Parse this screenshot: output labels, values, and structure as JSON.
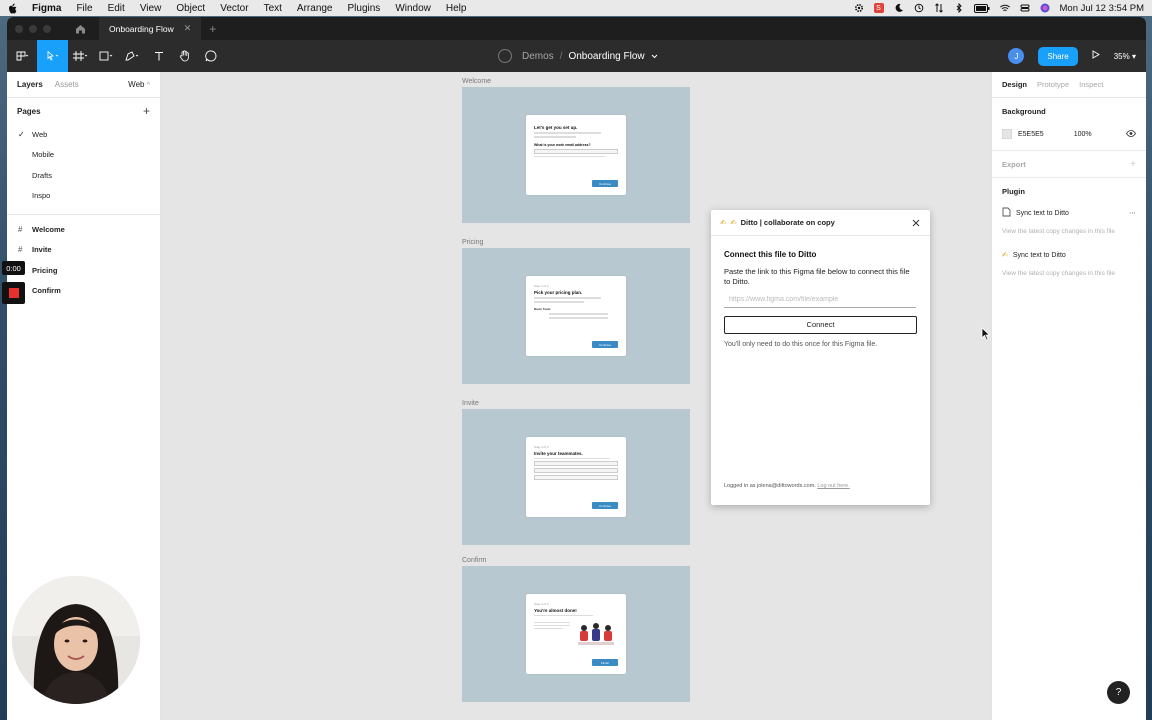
{
  "menubar": {
    "app": "Figma",
    "items": [
      "File",
      "Edit",
      "View",
      "Object",
      "Vector",
      "Text",
      "Arrange",
      "Plugins",
      "Window",
      "Help"
    ],
    "clock": "Mon Jul 12  3:54 PM",
    "status_badge": "S"
  },
  "tabbar": {
    "file_tab": "Onboarding Flow"
  },
  "toolbar": {
    "team": "Demos",
    "separator": "/",
    "file_name": "Onboarding Flow",
    "avatar_initial": "J",
    "share": "Share",
    "zoom": "35%"
  },
  "left_panel": {
    "tabs": [
      "Layers",
      "Assets"
    ],
    "page_selector": "Web",
    "pages_heading": "Pages",
    "pages": [
      "Web",
      "Mobile",
      "Drafts",
      "Inspo"
    ],
    "current_page": "Web",
    "frames": [
      "Welcome",
      "Invite",
      "Pricing",
      "Confirm"
    ]
  },
  "recorder": {
    "time": "0:00"
  },
  "canvas": {
    "frames": [
      {
        "label": "Welcome",
        "card_small": "",
        "card_title": "Let's get you set up.",
        "card_sub": "What is your work email address?",
        "button": "Continue"
      },
      {
        "label": "Pricing",
        "card_small": "Step 2 of 4",
        "card_title": "Pick your pricing plan.",
        "card_sub": "Basic  Team",
        "button": "Continue"
      },
      {
        "label": "Invite",
        "card_small": "Step 3 of 4",
        "card_title": "Invite your teammates.",
        "card_sub": "",
        "button": "Continue"
      },
      {
        "label": "Confirm",
        "card_small": "Step 4 of 4",
        "card_title": "You're almost done!",
        "card_sub": "",
        "button": "Finish"
      }
    ]
  },
  "plugin": {
    "header": "Ditto | collaborate on copy",
    "title": "Connect this file to Ditto",
    "description": "Paste the link to this Figma file below to connect this file to Ditto.",
    "input_placeholder": "https://www.figma.com/file/example",
    "connect": "Connect",
    "note": "You'll only need to do this once for this Figma file.",
    "footer_prefix": "Logged in as jolena@dittowords.com.",
    "footer_link": "Log out here."
  },
  "right_panel": {
    "tabs": [
      "Design",
      "Prototype",
      "Inspect"
    ],
    "background_title": "Background",
    "background_hex": "E5E5E5",
    "background_opacity": "100%",
    "export": "Export",
    "plugin_title": "Plugin",
    "plugin_items": [
      {
        "label": "Sync text to Ditto",
        "sub": "View the latest copy changes in this file"
      },
      {
        "label": "Sync text to Ditto",
        "sub": "View the latest copy changes in this file"
      }
    ]
  },
  "help": "?",
  "colors": {
    "accent": "#18a0fb",
    "frame_bg": "#b8c8d0",
    "canvas": "#e5e5e5",
    "record": "#e6312d"
  }
}
